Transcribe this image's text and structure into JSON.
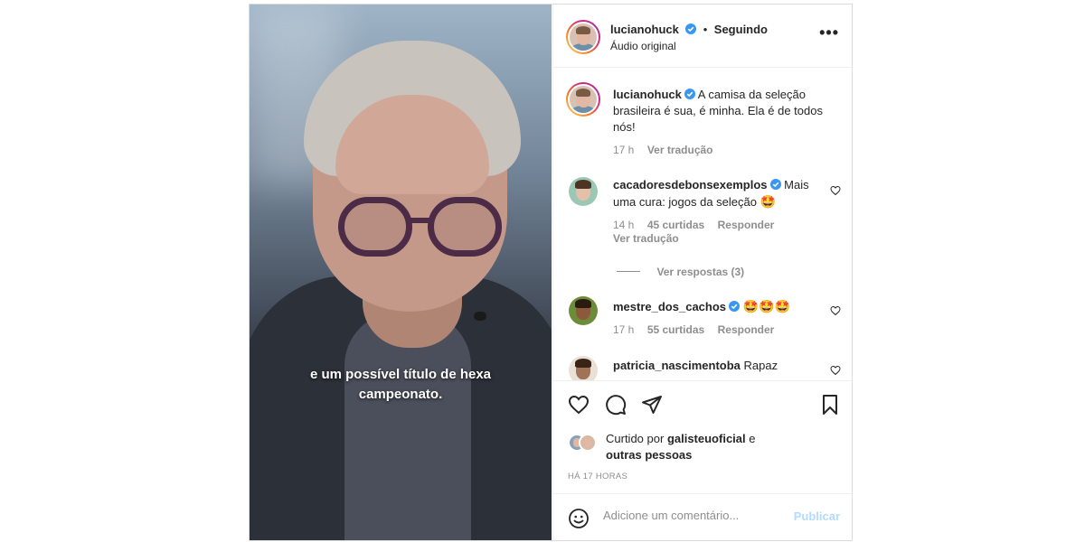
{
  "video": {
    "caption_line1": "e um possível título de hexa",
    "caption_line2": "campeonato."
  },
  "header": {
    "username": "lucianohuck",
    "follow_status": "Seguindo",
    "audio": "Áudio original",
    "more_icon": "more-horizontal-icon"
  },
  "caption": {
    "username": "lucianohuck",
    "text": "A camisa da seleção brasileira é sua, é minha. Ela é de todos nós!",
    "time": "17 h",
    "translate": "Ver tradução"
  },
  "comments": [
    {
      "username": "cacadoresdebonsexemplos",
      "text": "Mais uma cura: jogos da seleção",
      "emoji": "🤩",
      "time": "14 h",
      "likes": "45 curtidas",
      "reply": "Responder",
      "translate": "Ver tradução",
      "view_replies": "Ver respostas (3)"
    },
    {
      "username": "mestre_dos_cachos",
      "emoji": "🤩🤩🤩",
      "time": "17 h",
      "likes": "55 curtidas",
      "reply": "Responder"
    },
    {
      "username": "patricia_nascimentoba",
      "text": "Rapaz"
    }
  ],
  "actions": {
    "liked_by_prefix": "Curtido por",
    "liked_by_user": "galisteuoficial",
    "liked_by_suffix": "e",
    "liked_by_others": "outras pessoas",
    "time_ago": "HÁ 17 HORAS"
  },
  "add_comment": {
    "placeholder": "Adicione um comentário...",
    "publish": "Publicar"
  },
  "colors": {
    "verified": "#3897f0",
    "link_disabled": "#b3dbff",
    "secondary_text": "#8e8e8e"
  }
}
